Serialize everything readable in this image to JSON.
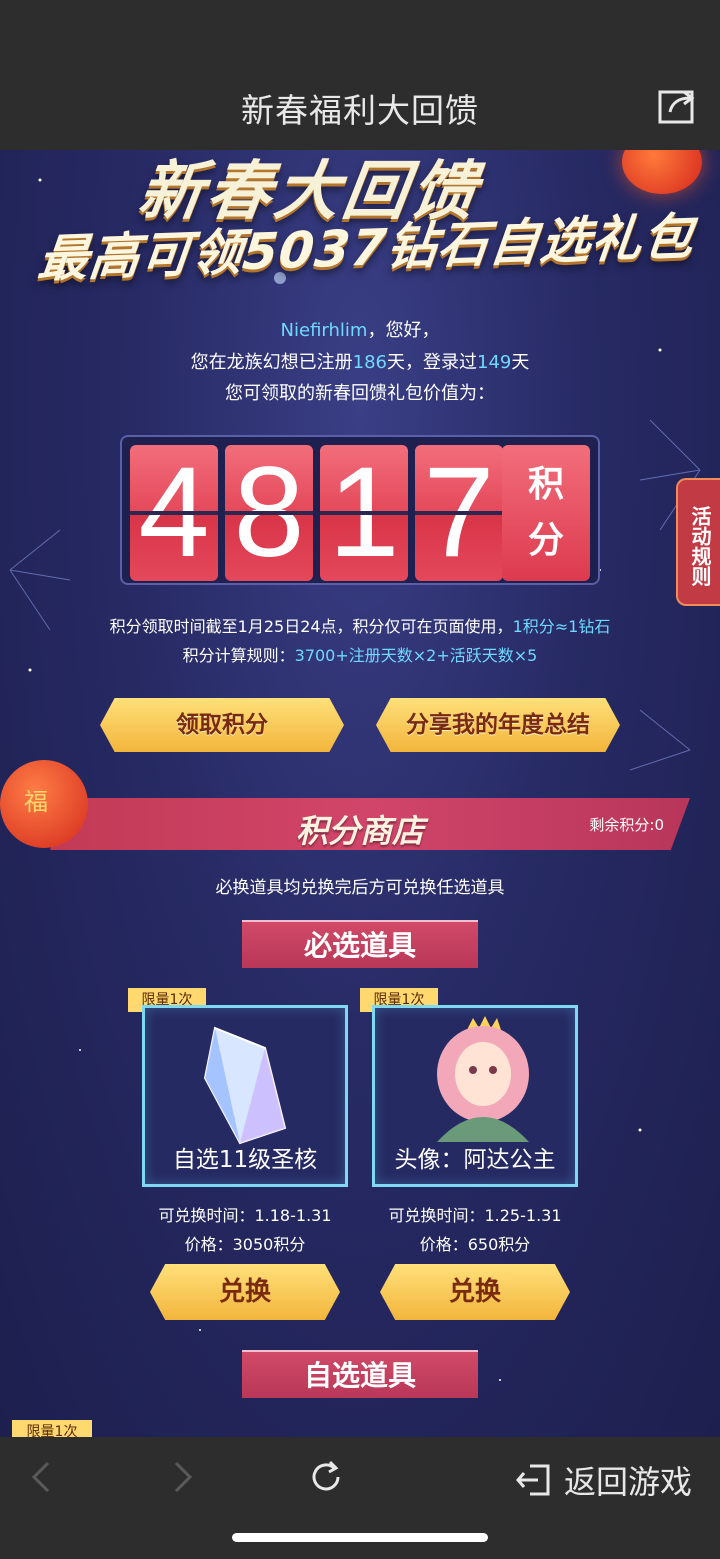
{
  "header": {
    "title": "新春福利大回馈",
    "share_icon": "share-icon"
  },
  "banner": {
    "line1": "新春大回馈",
    "line2": "最高可领5037钻石自选礼包"
  },
  "greeting": {
    "username": "Niefirhlim",
    "hello_suffix": "，您好，",
    "line2_prefix": "您在龙族幻想已注册",
    "register_days": "186",
    "line2_mid": "天，登录过",
    "login_days": "149",
    "line2_suffix": "天",
    "line3": "您可领取的新春回馈礼包价值为："
  },
  "points": {
    "digits": [
      "4",
      "8",
      "1",
      "7"
    ],
    "unit_line1": "积",
    "unit_line2": "分"
  },
  "rules": {
    "deadline_text": "积分领取时间截至1月25日24点，积分仅可在页面使用，",
    "ratio_text": "1积分≈1钻石",
    "formula_label": "积分计算规则：",
    "formula": "3700+注册天数×2+活跃天数×5"
  },
  "actions": {
    "claim_label": "领取积分",
    "share_label": "分享我的年度总结"
  },
  "side_tab": {
    "label": "活动规则"
  },
  "shop": {
    "title": "积分商店",
    "remaining": "剩余积分:0",
    "notice": "必换道具均兑换完后方可兑换任选道具",
    "lantern_char": "福",
    "required_label": "必选道具",
    "optional_label": "自选道具",
    "items": [
      {
        "limit": "限量1次",
        "name": "自选11级圣核",
        "time": "可兑换时间：1.18-1.31",
        "price": "价格：3050积分",
        "button": "兑换",
        "icon": "crystal-icon"
      },
      {
        "limit": "限量1次",
        "name": "头像：阿达公主",
        "time": "可兑换时间：1.25-1.31",
        "price": "价格：650积分",
        "button": "兑换",
        "icon": "princess-avatar-icon"
      }
    ],
    "next_limit": "限量1次"
  },
  "bottom_nav": {
    "back_game": "返回游戏"
  },
  "colors": {
    "accent_cyan": "#6fd9ff",
    "gold": "#f2b53c",
    "pink": "#d1456a",
    "bg": "#272a64"
  }
}
